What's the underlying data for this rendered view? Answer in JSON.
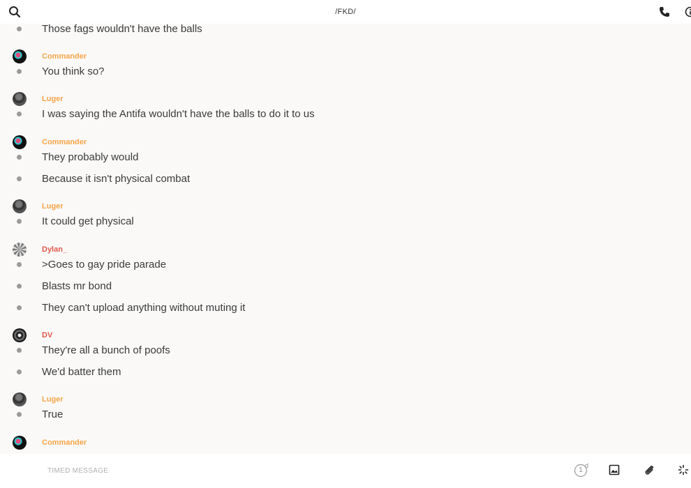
{
  "header": {
    "title": "/FKD/"
  },
  "composer": {
    "placeholder": "TIMED MESSAGE",
    "timer_value": "1",
    "timer_unit": "d"
  },
  "messages": [
    {
      "author": "",
      "avatar": "",
      "lines": [
        "Those fags wouldn't have the balls"
      ]
    },
    {
      "author": "Commander",
      "avatar": "commander",
      "lines": [
        "You think so?"
      ]
    },
    {
      "author": "Luger",
      "avatar": "luger",
      "lines": [
        "I was saying the Antifa wouldn't have the balls to do it to us"
      ]
    },
    {
      "author": "Commander",
      "avatar": "commander",
      "lines": [
        "They probably would",
        "Because it isn't physical combat"
      ]
    },
    {
      "author": "Luger",
      "avatar": "luger",
      "lines": [
        "It  could get physical"
      ]
    },
    {
      "author": "Dylan_",
      "avatar": "dylan",
      "lines": [
        ">Goes to gay pride parade",
        "Blasts mr bond",
        "They can't upload anything without muting it"
      ]
    },
    {
      "author": "DV",
      "avatar": "dv",
      "lines": [
        "They're all a bunch of poofs",
        "We'd batter them"
      ]
    },
    {
      "author": "Luger",
      "avatar": "luger",
      "lines": [
        "True"
      ]
    },
    {
      "author": "Commander",
      "avatar": "commander",
      "lines": []
    }
  ],
  "colors": {
    "author_orange": "#f5a54a",
    "author_red": "#e0584b",
    "bullet": "#9a9a9a"
  }
}
